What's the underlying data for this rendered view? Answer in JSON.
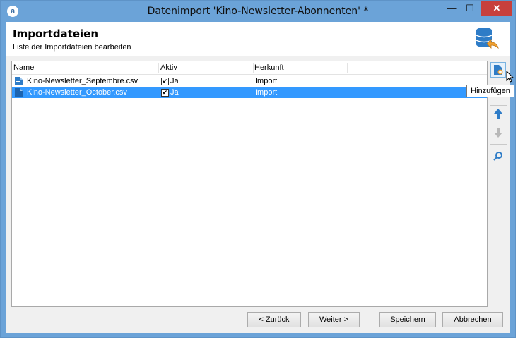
{
  "window": {
    "title": "Datenimport 'Kino-Newsletter-Abonnenten' *",
    "minimize_glyph": "—",
    "maximize_glyph": "☐",
    "close_glyph": "✕"
  },
  "header": {
    "title": "Importdateien",
    "subtitle": "Liste der Importdateien bearbeiten",
    "icon": "database-import-icon"
  },
  "list": {
    "columns": [
      "Name",
      "Aktiv",
      "Herkunft"
    ],
    "rows": [
      {
        "name": "Kino-Newsletter_Septembre.csv",
        "active": "Ja",
        "checked": true,
        "origin": "Import",
        "selected": false
      },
      {
        "name": "Kino-Newsletter_October.csv",
        "active": "Ja",
        "checked": true,
        "origin": "Import",
        "selected": true
      }
    ]
  },
  "side_toolbar": {
    "add_icon": "add-file-icon",
    "up_icon": "arrow-up-icon",
    "down_icon": "arrow-down-icon",
    "search_icon": "search-icon",
    "tooltip": "Hinzufügen"
  },
  "footer": {
    "back_label": "< Zurück",
    "next_label": "Weiter >",
    "save_label": "Speichern",
    "cancel_label": "Abbrechen"
  },
  "colors": {
    "window_border": "#6ba3d8",
    "selection": "#3399ff",
    "close_button": "#c7403c",
    "icon_blue": "#2e7cc7",
    "icon_orange": "#f0a030"
  }
}
